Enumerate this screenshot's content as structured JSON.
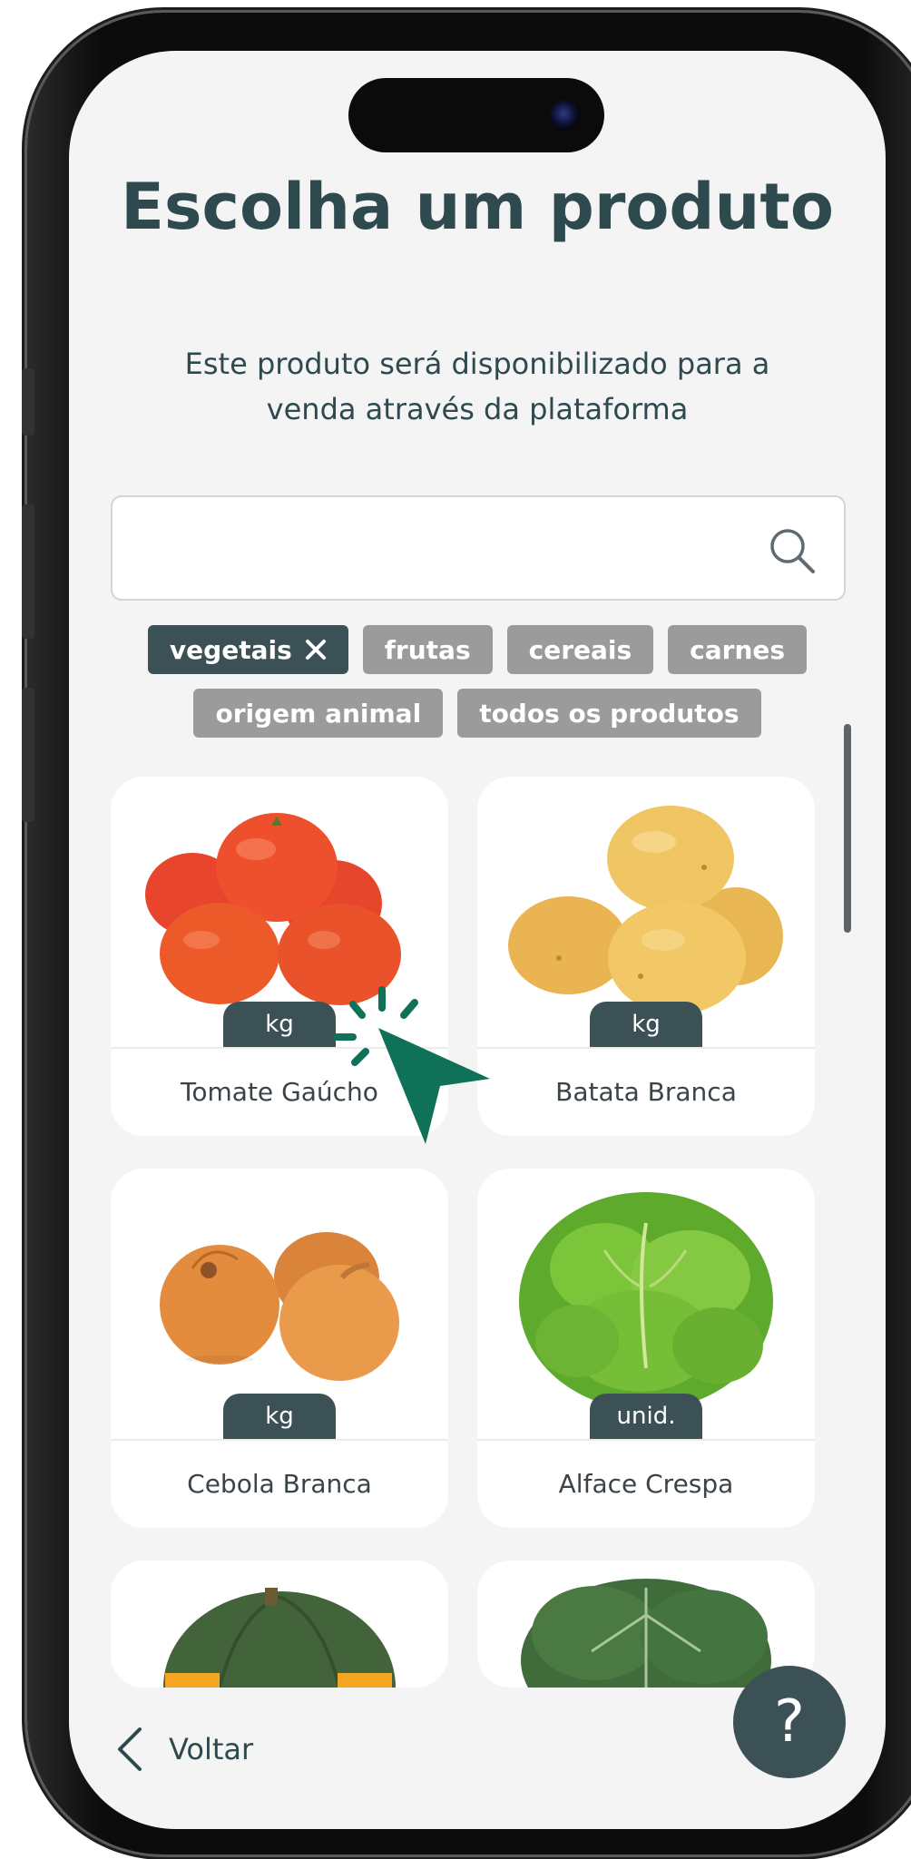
{
  "page": {
    "title": "Escolha um produto",
    "subtitle": "Este produto será disponibilizado para a venda através da plataforma"
  },
  "search": {
    "value": "",
    "placeholder": "",
    "icon": "search-icon"
  },
  "filters": [
    {
      "label": "vegetais",
      "active": true,
      "removable": true
    },
    {
      "label": "frutas",
      "active": false
    },
    {
      "label": "cereais",
      "active": false
    },
    {
      "label": "carnes",
      "active": false
    },
    {
      "label": "origem animal",
      "active": false
    },
    {
      "label": "todos os produtos",
      "active": false
    }
  ],
  "products": [
    {
      "name": "Tomate Gaúcho",
      "unit": "kg",
      "image": "tomato"
    },
    {
      "name": "Batata Branca",
      "unit": "kg",
      "image": "potato"
    },
    {
      "name": "Cebola Branca",
      "unit": "kg",
      "image": "onion"
    },
    {
      "name": "Alface Crespa",
      "unit": "unid.",
      "image": "lettuce"
    },
    {
      "name": "",
      "unit": "",
      "image": "pumpkin"
    },
    {
      "name": "",
      "unit": "",
      "image": "kale"
    }
  ],
  "footer": {
    "back_label": "Voltar",
    "help_label": "?"
  },
  "colors": {
    "primary": "#3c5156",
    "chip_inactive": "#9b9b9b",
    "cursor": "#0f7158",
    "background": "#f4f4f4"
  }
}
